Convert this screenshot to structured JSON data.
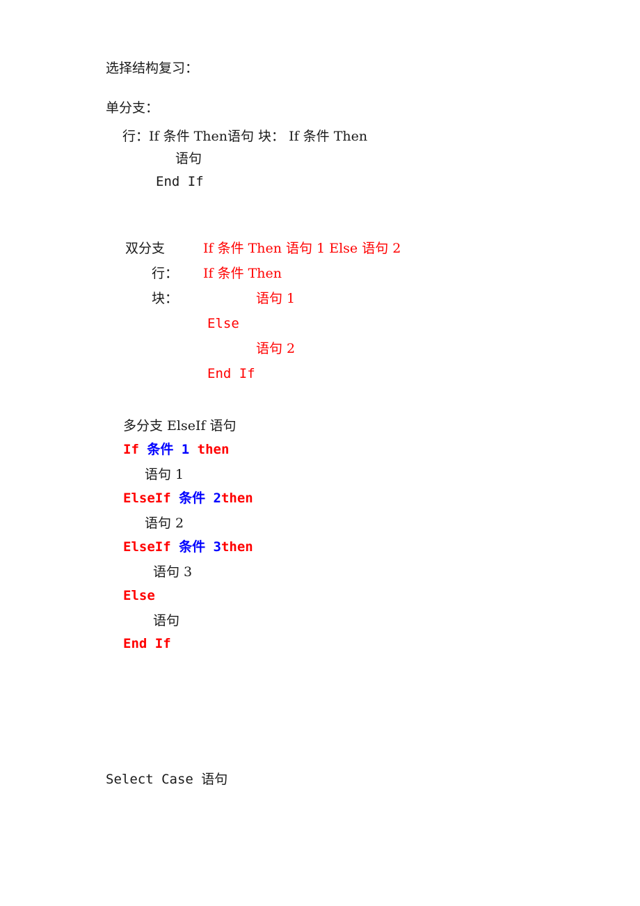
{
  "document": {
    "title": "选择结构复习：",
    "background": "#ffffff",
    "text_color": "#1a1a1a",
    "accent_red": "#ff0000",
    "accent_blue": "#0000ff"
  },
  "single_branch": {
    "heading": "单分支：",
    "line1": "行：If 条件 Then语句 块： If 条件 Then",
    "line2": "语句",
    "line3": "End If"
  },
  "double_branch": {
    "label1": "双分支",
    "label2": "行：",
    "label3": "块：",
    "code1": "If 条件 Then 语句 1 Else 语句 2",
    "code2": "If 条件 Then",
    "code3": "语句 1",
    "code4": "Else",
    "code5": "语句 2",
    "code6": "End If"
  },
  "multi_branch": {
    "heading": "多分支 ElseIf 语句",
    "l1_kw": "If ",
    "l1_cond": "条件 1",
    "l1_then": " then",
    "l2": "语句 1",
    "l3_kw": "ElseIf ",
    "l3_cond": "条件 2",
    "l3_then": "then",
    "l4": "语句 2",
    "l5_kw": "ElseIf ",
    "l5_cond": "条件 3",
    "l5_then": "then",
    "l6": "语句 3",
    "l7": "Else",
    "l8": "语句",
    "l9": "End If"
  },
  "select_case": {
    "heading": "Select Case 语句"
  }
}
